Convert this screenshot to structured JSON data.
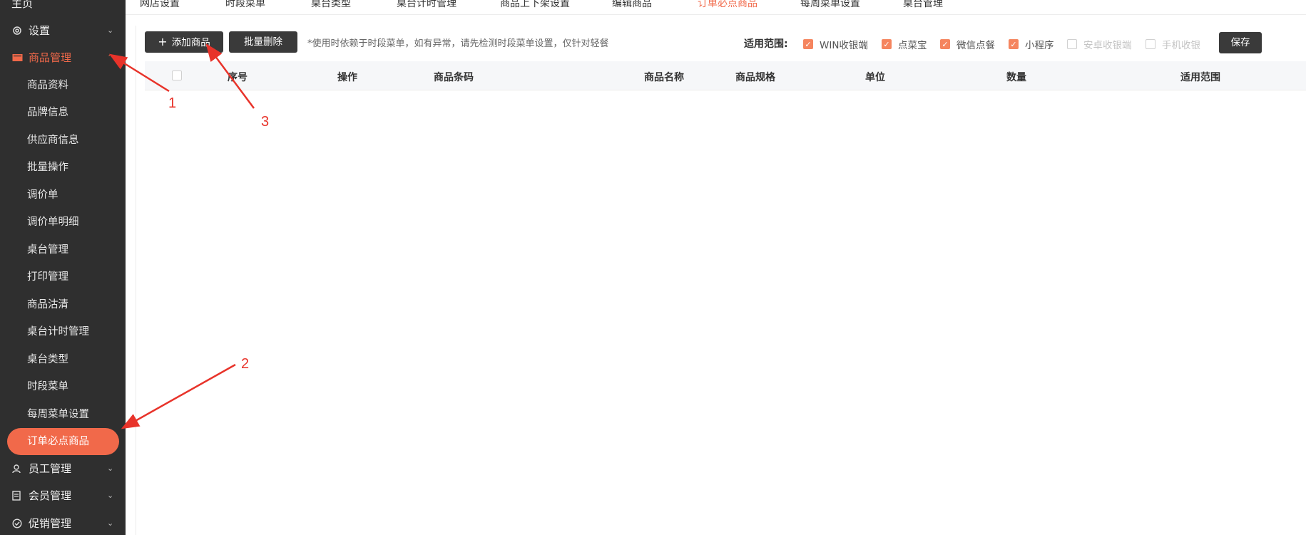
{
  "sidebar": {
    "home": "主页",
    "settings": "设置",
    "product_mgmt": "商品管理",
    "items": [
      "商品资料",
      "品牌信息",
      "供应商信息",
      "批量操作",
      "调价单",
      "调价单明细",
      "桌台管理",
      "打印管理",
      "商品沽清",
      "桌台计时管理",
      "桌台类型",
      "时段菜单",
      "每周菜单设置",
      "订单必点商品"
    ],
    "staff_mgmt": "员工管理",
    "member_mgmt": "会员管理",
    "promo_mgmt": "促销管理"
  },
  "tabs": [
    "网店设置",
    "时段菜单",
    "桌台类型",
    "桌台计时管理",
    "商品上下架设置",
    "编辑商品",
    "订单必点商品",
    "每周菜单设置",
    "桌台管理"
  ],
  "toolbar": {
    "add_label": "添加商品",
    "batch_delete_label": "批量删除",
    "hint": "*使用时依赖于时段菜单，如有异常，请先检测时段菜单设置，仅针对轻餐",
    "scope_label": "适用范围:",
    "scope_options": [
      {
        "label": "WIN收银端",
        "checked": true
      },
      {
        "label": "点菜宝",
        "checked": true
      },
      {
        "label": "微信点餐",
        "checked": true
      },
      {
        "label": "小程序",
        "checked": true
      },
      {
        "label": "安卓收银端",
        "checked": false
      },
      {
        "label": "手机收银",
        "checked": false
      }
    ],
    "save_label": "保存"
  },
  "table": {
    "columns": [
      "序号",
      "操作",
      "商品条码",
      "商品名称",
      "商品规格",
      "单位",
      "数量",
      "适用范围"
    ]
  },
  "annotations": [
    "1",
    "2",
    "3"
  ],
  "colors": {
    "accent": "#f1694a",
    "sidebar_bg": "#2f2f2f",
    "annotation": "#e8332a"
  }
}
